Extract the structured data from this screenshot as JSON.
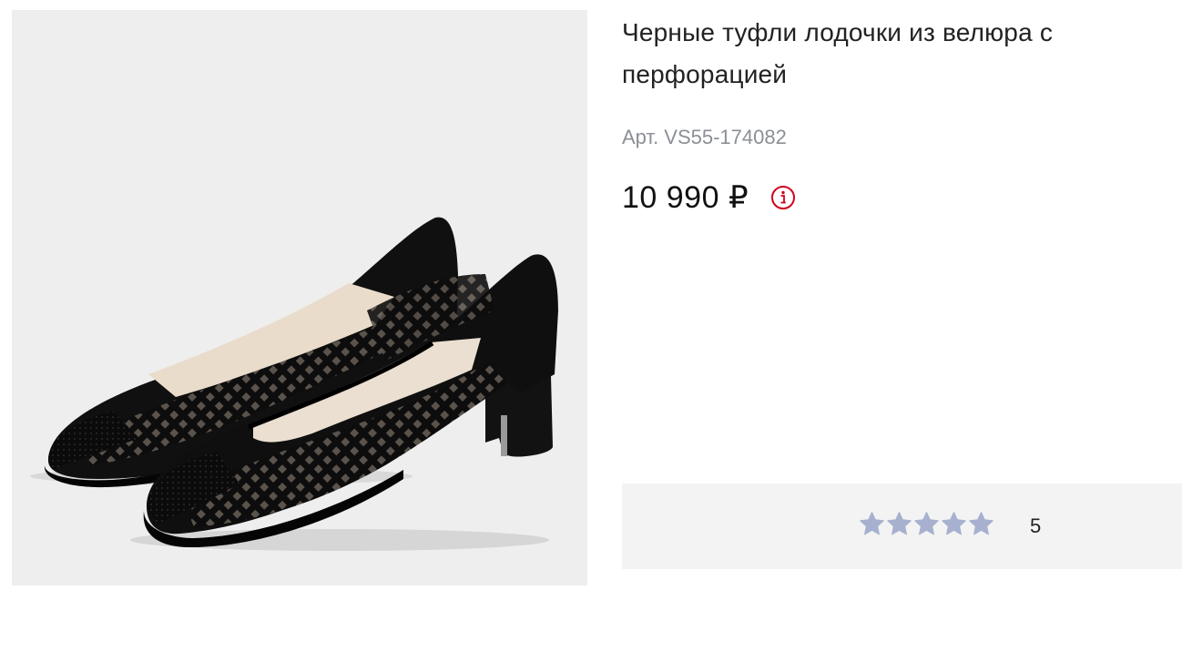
{
  "product": {
    "title": "Черные туфли лодочки из велюра с перфорацией",
    "article": "Арт. VS55-174082",
    "price": "10 990 ₽",
    "info_icon": "info-circle-icon",
    "image_alt": "shoe-pair-image"
  },
  "rating": {
    "value": "5",
    "stars_filled": 5,
    "stars_total": 5,
    "star_color": "#a7b1cf"
  },
  "colors": {
    "accent": "#d0021b",
    "panel_bg": "#f3f3f3",
    "image_bg": "#eeeeee"
  }
}
